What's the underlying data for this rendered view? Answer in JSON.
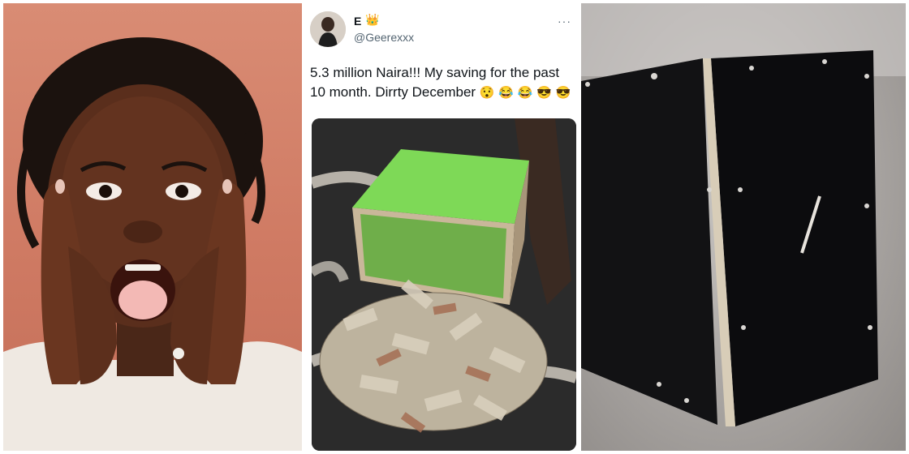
{
  "tweet": {
    "display_name": "E",
    "display_name_emoji": "👑",
    "handle": "@Geerexxx",
    "more_icon": "more-horizontal-icon",
    "text_line": "5.3 million Naira!!! My saving for the past 10 month. Dirrty December",
    "emojis": [
      "😯",
      "😂",
      "😂",
      "😎",
      "😎"
    ]
  },
  "panels": {
    "left": {
      "icon": "excited-child-photo"
    },
    "middle_media": {
      "icon": "money-box-photo"
    },
    "right": {
      "icon": "wooden-box-photo"
    }
  },
  "colors": {
    "tweet_text": "#0f1419",
    "handle": "#536471",
    "box_green": "#7ed957"
  }
}
